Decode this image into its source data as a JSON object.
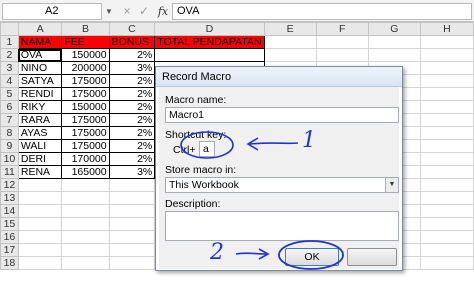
{
  "formula_bar": {
    "name_box": "A2",
    "fx_label": "fx",
    "cancel_glyph": "×",
    "enter_glyph": "✓",
    "formula": "OVA"
  },
  "columns": [
    "A",
    "B",
    "C",
    "D",
    "E",
    "F",
    "G",
    "H"
  ],
  "rows": [
    "1",
    "2",
    "3",
    "4",
    "5",
    "6",
    "7",
    "8",
    "9",
    "10",
    "11",
    "12",
    "13",
    "14",
    "15",
    "16",
    "17",
    "18"
  ],
  "table": {
    "headers": [
      "NAMA",
      "FEE",
      "BONUS",
      "TOTAL PENDAPATAN"
    ],
    "records": [
      [
        "OVA",
        "150000",
        "2%"
      ],
      [
        "NINO",
        "200000",
        "3%"
      ],
      [
        "SATYA",
        "175000",
        "2%"
      ],
      [
        "RENDI",
        "175000",
        "2%"
      ],
      [
        "RIKY",
        "150000",
        "2%"
      ],
      [
        "RARA",
        "175000",
        "2%"
      ],
      [
        "AYAS",
        "175000",
        "2%"
      ],
      [
        "WALI",
        "175000",
        "2%"
      ],
      [
        "DERI",
        "170000",
        "2%"
      ],
      [
        "RENA",
        "165000",
        "3%"
      ]
    ]
  },
  "dialog": {
    "title": "Record Macro",
    "macro_name_label": "Macro name:",
    "macro_name_value": "Macro1",
    "shortcut_label": "Shortcut key:",
    "ctrl_label": "Ctrl+",
    "shortcut_value": "a",
    "store_label": "Store macro in:",
    "store_value": "This Workbook",
    "description_label": "Description:",
    "description_value": "",
    "ok_label": "OK"
  },
  "annotations": {
    "step1": "1",
    "step2": "2",
    "color": "#2233cc"
  },
  "colors": {
    "header_fill": "#ff0000",
    "selection": "#000000"
  }
}
